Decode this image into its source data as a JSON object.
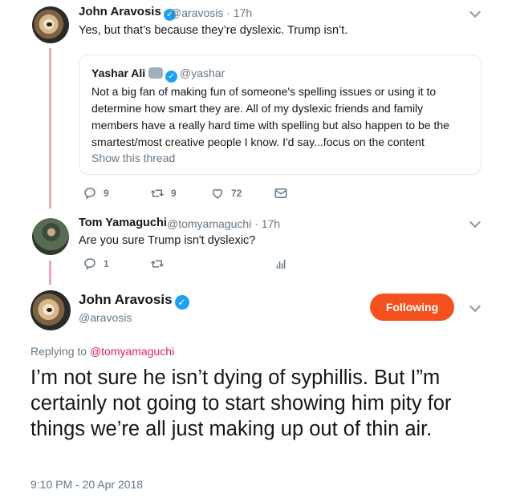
{
  "tweet1": {
    "name": "John Aravosis",
    "handle_time": "@aravosis · 17h",
    "text": "Yes, but that’s because they’re dyslexic. Trump isn’t."
  },
  "quoted": {
    "name": "Yashar Ali",
    "handle": "@yashar",
    "text": "Not a big fan of making fun of someone's spelling issues or using it to determine how smart they are. All of my dyslexic friends and family members have a really hard time with spelling but also happen to be the smartest/most creative people I know. I'd say...focus on the content",
    "show_thread": "Show this thread"
  },
  "tweet1_actions": {
    "replies": "9",
    "retweets": "9",
    "likes": "72"
  },
  "tweet2": {
    "name": "Tom Yamaguchi",
    "handle_time": "@tomyamaguchi · 17h",
    "text": "Are you sure Trump isn't dyslexic?"
  },
  "tweet2_actions": {
    "replies": "1"
  },
  "main": {
    "name": "John Aravosis",
    "handle": "@aravosis",
    "follow_label": "Following",
    "replying_prefix": "Replying to",
    "replying_handle": "@tomyamaguchi",
    "text": "I’m not sure he isn’t dying of syphillis. But I”m certainly not going to start showing him pity for things we’re all just making up out of thin air.",
    "timestamp": "9:10 PM - 20 Apr 2018"
  },
  "colors": {
    "accent": "#f4511e",
    "verified": "#1da1f2",
    "thread_line": "#e8a9b0",
    "reply_link": "#e0245e"
  }
}
